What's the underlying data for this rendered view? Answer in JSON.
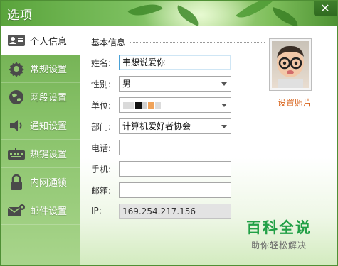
{
  "window": {
    "title": "选项"
  },
  "sidebar": {
    "items": [
      {
        "label": "个人信息",
        "icon": "id-card-icon"
      },
      {
        "label": "常规设置",
        "icon": "gear-icon"
      },
      {
        "label": "网段设置",
        "icon": "globe-icon"
      },
      {
        "label": "通知设置",
        "icon": "speaker-icon"
      },
      {
        "label": "热键设置",
        "icon": "keyboard-icon"
      },
      {
        "label": "内网通锁",
        "icon": "lock-icon"
      },
      {
        "label": "邮件设置",
        "icon": "mail-gear-icon"
      }
    ],
    "active_index": 0
  },
  "form": {
    "section_title": "基本信息",
    "name": {
      "label": "姓名:",
      "value": "韦想说爱你"
    },
    "gender": {
      "label": "性别:",
      "value": "男"
    },
    "unit": {
      "label": "单位:",
      "value": ""
    },
    "department": {
      "label": "部门:",
      "value": "计算机爱好者协会"
    },
    "phone": {
      "label": "电话:",
      "value": ""
    },
    "mobile": {
      "label": "手机:",
      "value": ""
    },
    "email": {
      "label": "邮箱:",
      "value": ""
    },
    "ip": {
      "label": "IP:",
      "value": "169.254.217.156"
    }
  },
  "avatar": {
    "link_label": "设置照片"
  },
  "watermark": {
    "title": "百科全说",
    "subtitle": "助你轻松解决"
  },
  "colors": {
    "accent_green": "#5aa43c",
    "link_orange": "#d9641c",
    "watermark_green": "#22a046"
  }
}
